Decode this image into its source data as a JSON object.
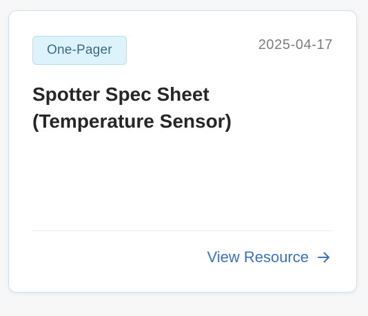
{
  "card": {
    "badge": "One-Pager",
    "date": "2025-04-17",
    "title": "Spotter Spec Sheet (Temperature Sensor)",
    "link_label": "View Resource",
    "link_icon": "arrow-right-icon"
  },
  "colors": {
    "badge_background": "#dcf3fb",
    "badge_text": "#3c6a7e",
    "link": "#3a71c1",
    "card_border": "#cfe0f4"
  }
}
